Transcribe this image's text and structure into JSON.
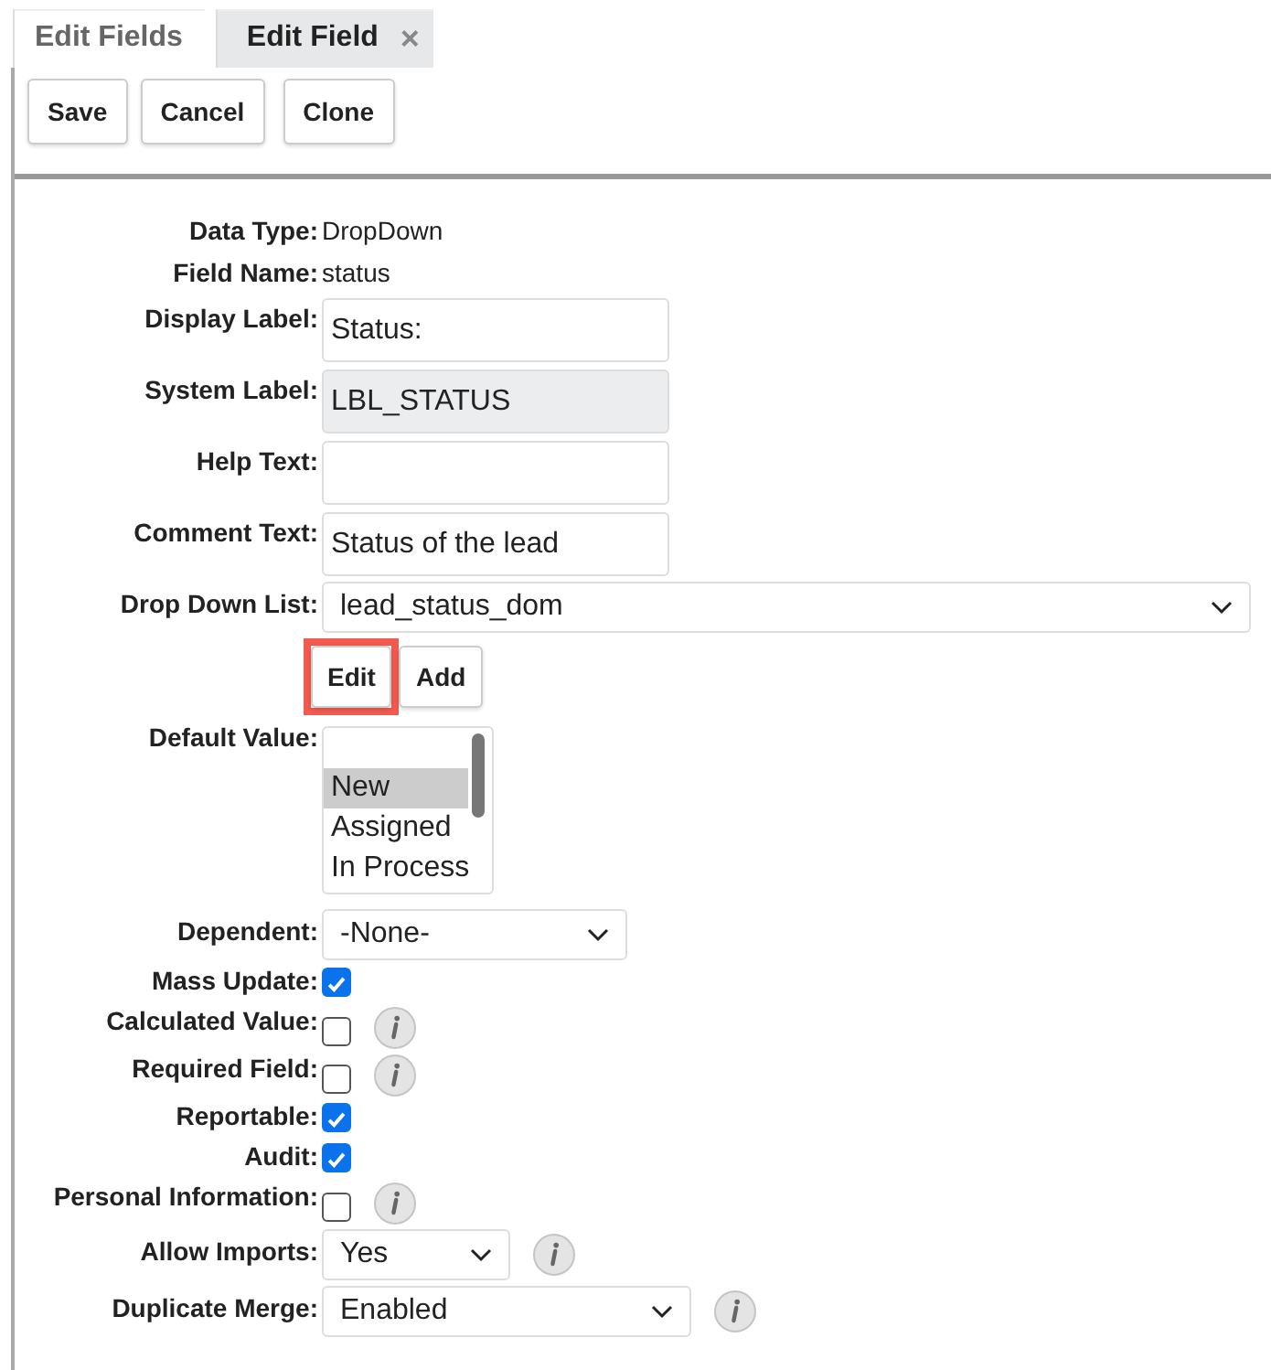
{
  "tabs": [
    {
      "label": "Edit Fields",
      "selected": false
    },
    {
      "label": "Edit Field",
      "selected": true,
      "close": "×"
    }
  ],
  "toolbar": [
    "Save",
    "Cancel",
    "Clone"
  ],
  "form": [
    {
      "kind": "static",
      "label": "Data Type:",
      "value": "DropDown"
    },
    {
      "kind": "static",
      "label": "Field Name:",
      "value": "status"
    },
    {
      "kind": "text",
      "label": "Display Label:",
      "value": "Status:",
      "disabled": false
    },
    {
      "kind": "text",
      "label": "System Label:",
      "value": "LBL_STATUS",
      "disabled": true
    },
    {
      "kind": "text",
      "label": "Help Text:",
      "disabled": false
    },
    {
      "kind": "text",
      "label": "Comment Text:",
      "value": "Status of the lead",
      "disabled": false
    },
    {
      "kind": "select",
      "label": "Drop Down List:",
      "value": "lead_status_dom"
    },
    {
      "kind": "buttons",
      "buttons": [
        {
          "label": "Edit",
          "highlighted": true
        },
        {
          "label": "Add",
          "highlighted": false
        }
      ]
    },
    {
      "kind": "listbox",
      "label": "Default Value:",
      "options": [
        {
          "label": "New",
          "selected": true
        },
        {
          "label": "Assigned",
          "selected": false
        },
        {
          "label": "In Process",
          "selected": false
        }
      ]
    },
    {
      "kind": "select",
      "label": "Dependent:",
      "value": "-None-"
    },
    {
      "kind": "checkbox",
      "label": "Mass Update:",
      "checked": true
    },
    {
      "kind": "checkbox",
      "label": "Calculated Value:",
      "checked": false,
      "info": true
    },
    {
      "kind": "checkbox",
      "label": "Required Field:",
      "checked": false,
      "info": true
    },
    {
      "kind": "checkbox",
      "label": "Reportable:",
      "checked": true
    },
    {
      "kind": "checkbox",
      "label": "Audit:",
      "checked": true
    },
    {
      "kind": "checkbox",
      "label": "Personal Information:",
      "checked": false,
      "info": true
    },
    {
      "kind": "select",
      "label": "Allow Imports:",
      "value": "Yes",
      "info": true
    },
    {
      "kind": "select",
      "label": "Duplicate Merge:",
      "value": "Enabled",
      "info": true
    }
  ]
}
